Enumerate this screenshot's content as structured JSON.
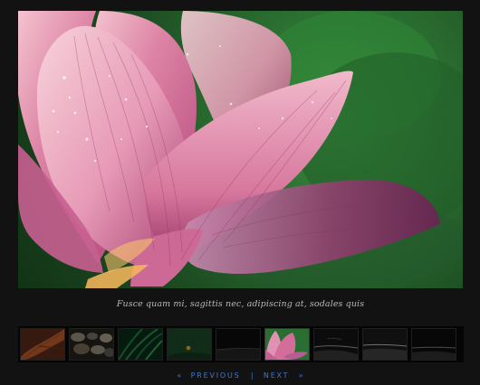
{
  "caption": "Fusce quam mi, sagittis nec, adipiscing at, sodales quis",
  "nav": {
    "previous_arrow": "«",
    "previous_label": "PREVIOUS",
    "separator": "|",
    "next_label": "NEXT",
    "next_arrow": "»"
  },
  "colors": {
    "background": "#121212",
    "nav_link": "#3f77c9",
    "caption_text": "#b8b8b8",
    "thumb_border": "#2a2a2a"
  },
  "thumbnails": [
    {
      "name": "thumbnail-leaf",
      "active": false
    },
    {
      "name": "thumbnail-stones",
      "active": false
    },
    {
      "name": "thumbnail-grass",
      "active": false
    },
    {
      "name": "thumbnail-green-field",
      "active": false
    },
    {
      "name": "thumbnail-dark-landscape",
      "active": false
    },
    {
      "name": "thumbnail-lotus",
      "active": true
    },
    {
      "name": "thumbnail-shoreline",
      "active": false
    },
    {
      "name": "thumbnail-beach",
      "active": false
    },
    {
      "name": "thumbnail-sea-horizon",
      "active": false
    }
  ]
}
